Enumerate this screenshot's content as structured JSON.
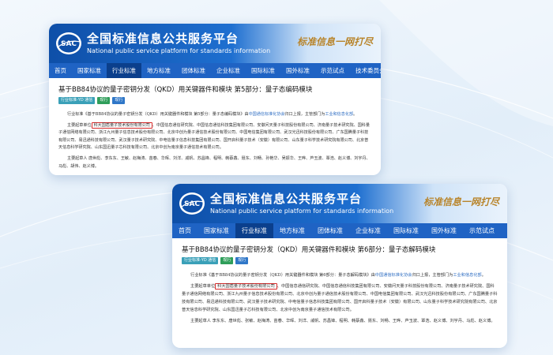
{
  "site": {
    "title_cn": "全国标准信息公共服务平台",
    "title_en": "National public service platform  for standards information",
    "logo_text": "SAC",
    "slogan": "标准信息一网打尽"
  },
  "nav": [
    {
      "label": "首页"
    },
    {
      "label": "国家标准"
    },
    {
      "label": "行业标准",
      "active": true
    },
    {
      "label": "地方标准"
    },
    {
      "label": "团体标准"
    },
    {
      "label": "企业标准"
    },
    {
      "label": "国际标准"
    },
    {
      "label": "国外标准"
    },
    {
      "label": "示范试点"
    },
    {
      "label": "技术委员会"
    }
  ],
  "tags": [
    "行业标准-YD 通信",
    "现行",
    "现行"
  ],
  "card1": {
    "title": "基于BB84协议的量子密钥分发（QKD）用关键器件和模块 第5部分：量子态编码模块",
    "p1_pre": "行业标准《基于BB84协议的量子密钥分发（QKD）用关键器件和模块 第5部分：量子态编码模块》由",
    "p1_link": "中国通信标准化协会",
    "p1_mid": "归口上报，主管部门为",
    "p1_link2": "工业和信息化部",
    "p1_end": "。",
    "p2_pre": "主要起草单位",
    "p2_highlight": "科大国盾量子技术股份有限公司",
    "p2_rest": "、中国信息通信研究院、中国信息通信科技集团有限公司、安徽问天量子科技股份有限公司、济南量子技术研究院、国科量子通信网络有限公司、浙江九州量子信息技术股份有限公司、北京中创为量子通信技术股份有限公司、中国电信集团有限公司、武汉光迅科技股份有限公司、广东国腾量子科技有限公司、易迅通科技有限公司、武汉量子技术研究院、中电信量子信息科技集团有限公司、国开启科量子技术（安徽）有限公司、山东量子科学技术研究院有限公司、北京普天信息科学研究院、山东国迅量子芯科技有限公司、北京中创为南京量子通信技术有限公司。",
    "p3": "主要起草人 唐世彪、李东东、王敏、赵梅涛、苗春、华晖、刘洋、戚帆、苏昌锋、程明、韩蔡鑫、聂东、刘畅、孙艳华、吴振华、王晔、芦玉波、覃浩、赵义博、刘宇丹、马彪、胡伟、赵义博。"
  },
  "card2": {
    "title": "基于BB84协议的量子密钥分发（QKD）用关键器件和模块 第6部分：量子态解码模块",
    "p1_pre": "行业标准《基于BB84协议的量子密钥分发（QKD）用关键器件和模块 第6部分：量子态解码模块》由",
    "p1_link": "中国通信标准化协会",
    "p1_mid": "归口上报，主管部门为",
    "p1_link2": "工业和信息化部",
    "p1_end": "。",
    "p2_pre": "主要起草单位",
    "p2_highlight": "科大国盾量子技术股份有限公司",
    "p2_rest": "、中国信息通信研究院、中国信息通信科技集团有限公司、安徽问天量子科技股份有限公司、济南量子技术研究院、国科量子通信网络有限公司、浙江九州量子信息技术股份有限公司、北京中创为量子通信技术股份有限公司、中国电信集团有限公司、武汉光迅科技股份有限公司、广东国腾量子科技有限公司、易迅通科技有限公司、武汉量子技术研究院、中电信量子信息科技集团有限公司、国开启科量子技术（安徽）有限公司、山东量子科学技术研究院有限公司、北京普天信息科学研究院、山东国迅量子芯科技有限公司、北京中创为南京量子通信技术有限公司。",
    "p3": "主要起草人 李东东、唐世彪、张敏、赵梅涛、苗春、华晖、刘洋、戚帆、苏昌锋、程明、韩蔡鑫、聂东、刘畅、王晔、芦玉波、覃浩、赵义博、刘宇丹、马彪、赵义博。"
  }
}
